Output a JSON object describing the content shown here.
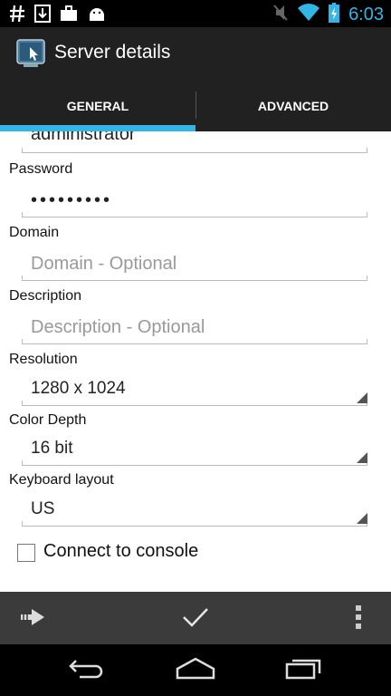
{
  "status_bar": {
    "time": "6:03",
    "left_icons": [
      "hash-icon",
      "download-icon",
      "briefcase-icon",
      "android-icon"
    ],
    "right_icons": [
      "mute-icon",
      "wifi-icon",
      "battery-icon"
    ]
  },
  "action_bar": {
    "title": "Server details",
    "icon": "app-icon"
  },
  "tabs": [
    {
      "label": "GENERAL",
      "selected": true
    },
    {
      "label": "ADVANCED",
      "selected": false
    }
  ],
  "form": {
    "username_value": "administrator",
    "password": {
      "label": "Password",
      "value": "•••••••••"
    },
    "domain": {
      "label": "Domain",
      "placeholder": "Domain - Optional"
    },
    "description": {
      "label": "Description",
      "placeholder": "Description - Optional"
    },
    "resolution": {
      "label": "Resolution",
      "value": "1280 x 1024"
    },
    "color_depth": {
      "label": "Color Depth",
      "value": "16 bit"
    },
    "keyboard_layout": {
      "label": "Keyboard layout",
      "value": "US"
    },
    "connect_to_console": {
      "label": "Connect to console",
      "checked": false
    }
  },
  "bottom_bar": {
    "icons": [
      "connect-arrow-icon",
      "checkmark-icon",
      "overflow-menu-icon"
    ]
  },
  "nav_bar": {
    "icons": [
      "back-icon",
      "home-icon",
      "recents-icon"
    ]
  },
  "colors": {
    "accent": "#33b5e5",
    "action_bar": "#212121",
    "bottom_bar": "#3b3b3b"
  }
}
